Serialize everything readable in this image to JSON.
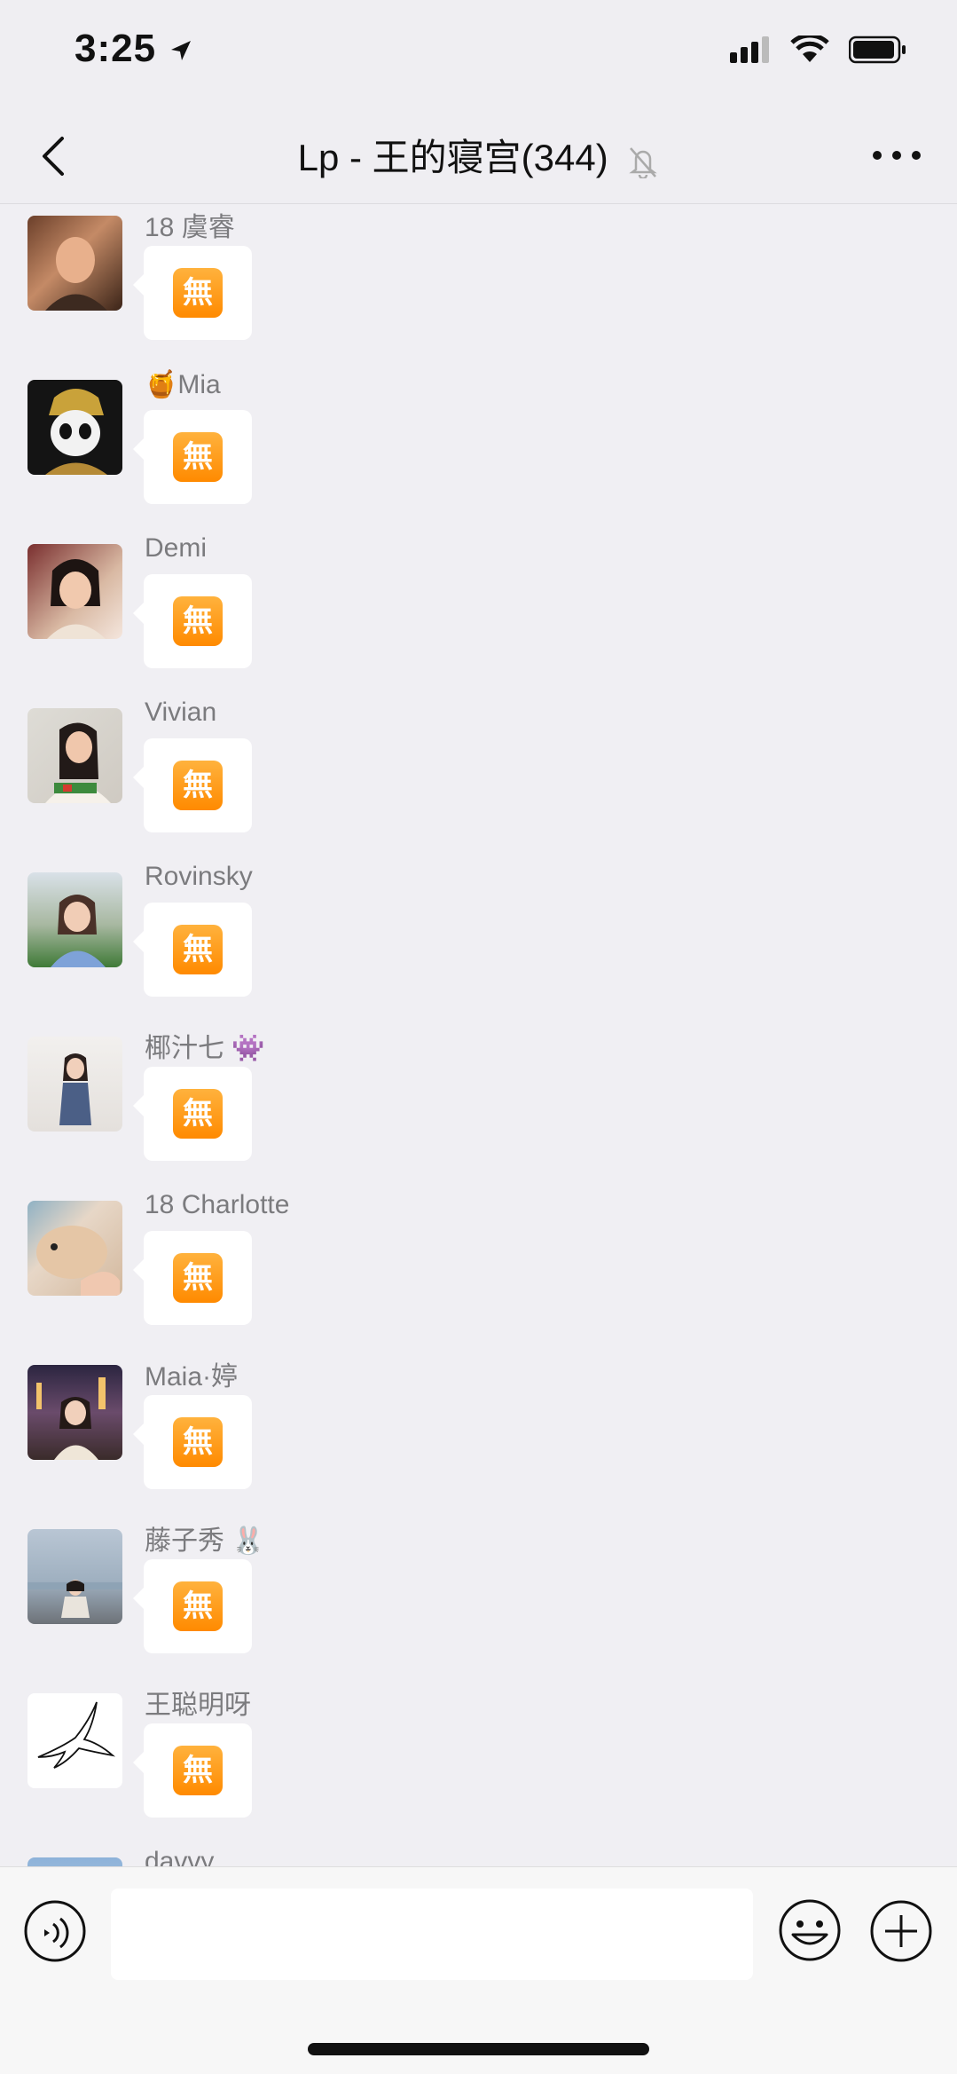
{
  "status": {
    "time": "3:25"
  },
  "header": {
    "title": "Lp - 王的寝宫(344)"
  },
  "messages": [
    {
      "sender": "18 虞睿",
      "content": "無"
    },
    {
      "sender": "🍯Mia",
      "content": "無"
    },
    {
      "sender": "Demi",
      "content": "無"
    },
    {
      "sender": "Vivian",
      "content": "無"
    },
    {
      "sender": "Rovinsky",
      "content": "無"
    },
    {
      "sender": "椰汁七 👾",
      "content": "無"
    },
    {
      "sender": "18 Charlotte",
      "content": "無"
    },
    {
      "sender": "Maia·婷",
      "content": "無"
    },
    {
      "sender": "藤子秀 🐰",
      "content": "無"
    },
    {
      "sender": "王聪明呀",
      "content": "無"
    },
    {
      "sender": "davvy",
      "content": ""
    }
  ],
  "input": {
    "placeholder": ""
  },
  "colors": {
    "accent_emoji": "#ff9a10",
    "background": "#f0eff3",
    "bubble": "#ffffff"
  }
}
